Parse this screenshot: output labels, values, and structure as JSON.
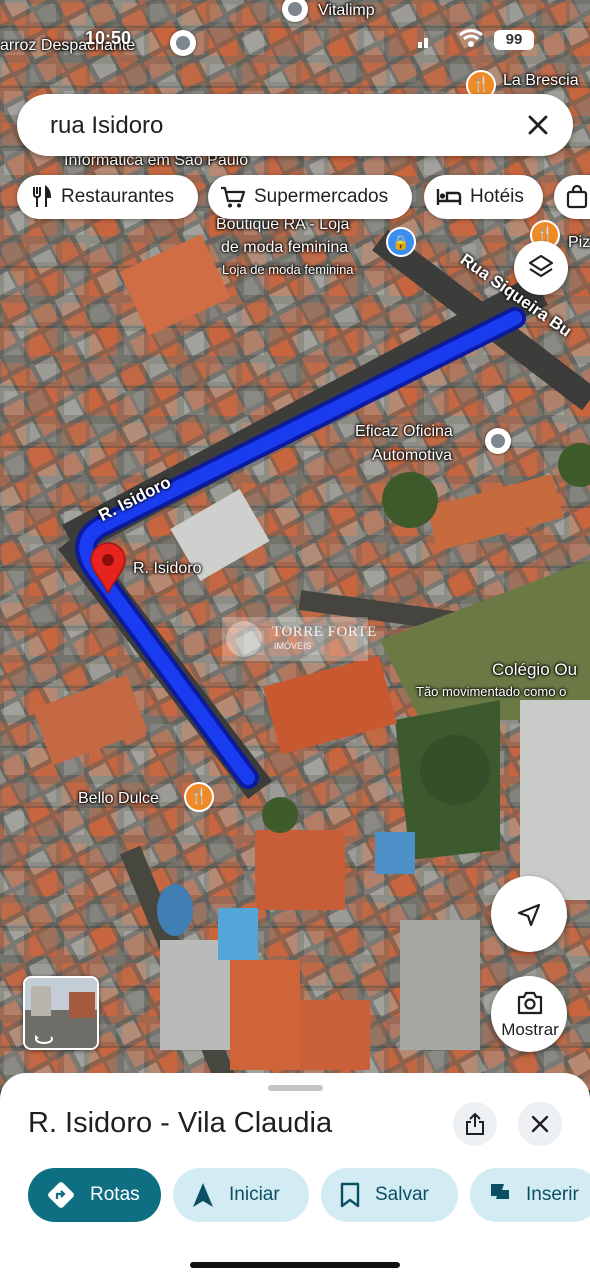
{
  "status_bar": {
    "time": "10:50",
    "battery": "99"
  },
  "search": {
    "query": "rua Isidoro"
  },
  "chips": [
    {
      "label": "Restaurantes",
      "icon": "fork-knife-icon"
    },
    {
      "label": "Supermercados",
      "icon": "cart-icon"
    },
    {
      "label": "Hotéis",
      "icon": "bed-icon"
    }
  ],
  "map": {
    "labels": {
      "vitalimp": "Vitalimp",
      "despachante": "arroz Despachante",
      "brescia": "La Brescia",
      "informatica": "Informática em São Paulo",
      "boutique_1": "Boutique RA - Loja",
      "boutique_2": "de moda feminina",
      "boutique_3": "Loja de moda feminina",
      "pizza": "Piz",
      "eficaz_1": "Eficaz Oficina",
      "eficaz_2": "Automotiva",
      "pin_label": "R. Isidoro",
      "colegio_1": "Colégio Ou",
      "colegio_2": "Tão movimentado como o",
      "bello": "Bello Dulce",
      "watermark_1": "TORRE FORTE",
      "watermark_2": "IMÓVEIS"
    },
    "streets": {
      "isidoro": "R. Isidoro",
      "siqueira": "Rua Siqueira Bu"
    },
    "route_color": "#1a3cf0",
    "pin_color": "#e52420"
  },
  "buttons": {
    "camera_label": "Mostrar"
  },
  "sheet": {
    "title": "R. Isidoro - Vila Claudia",
    "actions": [
      {
        "label": "Rotas",
        "icon": "directions-icon"
      },
      {
        "label": "Iniciar",
        "icon": "navigation-arrow-icon"
      },
      {
        "label": "Salvar",
        "icon": "bookmark-icon"
      },
      {
        "label": "Inserir",
        "icon": "flag-icon"
      }
    ]
  }
}
